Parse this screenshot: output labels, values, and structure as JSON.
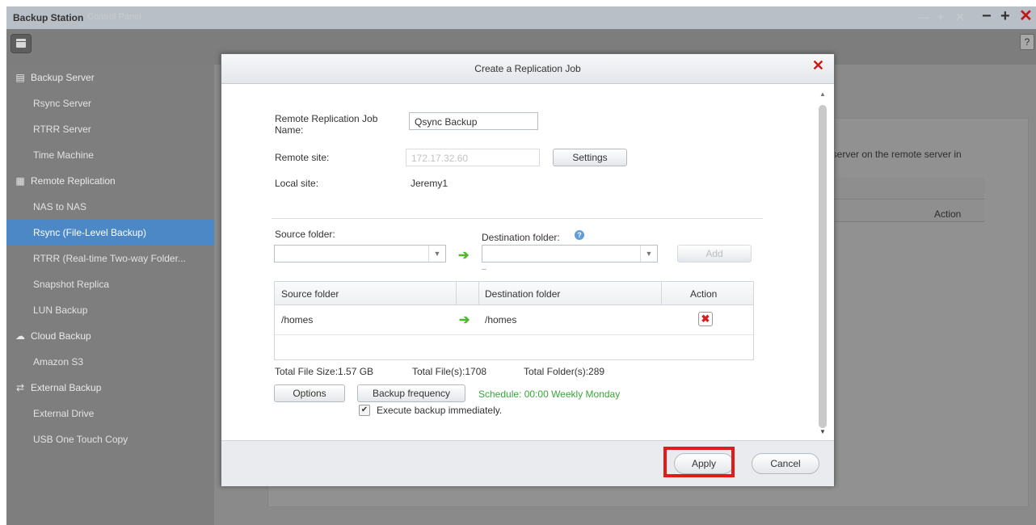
{
  "window": {
    "title": "Backup Station",
    "ghost_title": "Control Panel",
    "ghost_controls": [
      "—",
      "+",
      "✕"
    ],
    "controls": {
      "minimize": "−",
      "maximize": "+",
      "close": "✕"
    }
  },
  "toolbar": {
    "help_label": "?"
  },
  "sidebar": {
    "items": [
      {
        "label": "Backup Server",
        "type": "section",
        "icon": "server-icon"
      },
      {
        "label": "Rsync Server",
        "type": "sub"
      },
      {
        "label": "RTRR Server",
        "type": "sub"
      },
      {
        "label": "Time Machine",
        "type": "sub"
      },
      {
        "label": "Remote Replication",
        "type": "section",
        "icon": "replication-icon"
      },
      {
        "label": "NAS to NAS",
        "type": "sub"
      },
      {
        "label": "Rsync (File-Level Backup)",
        "type": "sub",
        "active": true
      },
      {
        "label": "RTRR (Real-time Two-way Folder...",
        "type": "sub"
      },
      {
        "label": "Snapshot Replica",
        "type": "sub"
      },
      {
        "label": "LUN Backup",
        "type": "sub"
      },
      {
        "label": "Cloud Backup",
        "type": "section",
        "icon": "cloud-icon"
      },
      {
        "label": "Amazon S3",
        "type": "sub"
      },
      {
        "label": "External Backup",
        "type": "section",
        "icon": "sync-icon"
      },
      {
        "label": "External Drive",
        "type": "sub"
      },
      {
        "label": "USB One Touch Copy",
        "type": "sub"
      }
    ]
  },
  "main": {
    "description_fragment": ": server on the remote server in",
    "action_header": "Action"
  },
  "dialog": {
    "title": "Create a Replication Job",
    "close_symbol": "✕",
    "job_name_label": "Remote Replication Job Name:",
    "job_name_value": "Qsync Backup",
    "remote_site_label": "Remote site:",
    "remote_site_value": "172.17.32.60",
    "settings_button": "Settings",
    "local_site_label": "Local site:",
    "local_site_value": "Jeremy1",
    "source_folder_label": "Source folder:",
    "destination_folder_label": "Destination folder:",
    "help_symbol": "?",
    "add_button": "Add",
    "dash": "–",
    "table": {
      "headers": [
        "Source folder",
        "Destination folder",
        "Action"
      ],
      "rows": [
        {
          "source": "/homes",
          "destination": "/homes"
        }
      ]
    },
    "stats": {
      "total_size": "Total File Size:1.57 GB",
      "total_files": "Total File(s):1708",
      "total_folders": "Total Folder(s):289"
    },
    "options_button": "Options",
    "backup_frequency_button": "Backup frequency",
    "schedule_text": "Schedule: 00:00 Weekly Monday",
    "execute_checkbox_label": "Execute backup immediately.",
    "execute_checked": true,
    "apply_button": "Apply",
    "cancel_button": "Cancel"
  },
  "colors": {
    "accent": "#4c88c6",
    "highlight": "#e21a1a",
    "schedule_green": "#3aa53a",
    "arrow_green": "#4eb82a",
    "close_red": "#d31414"
  }
}
